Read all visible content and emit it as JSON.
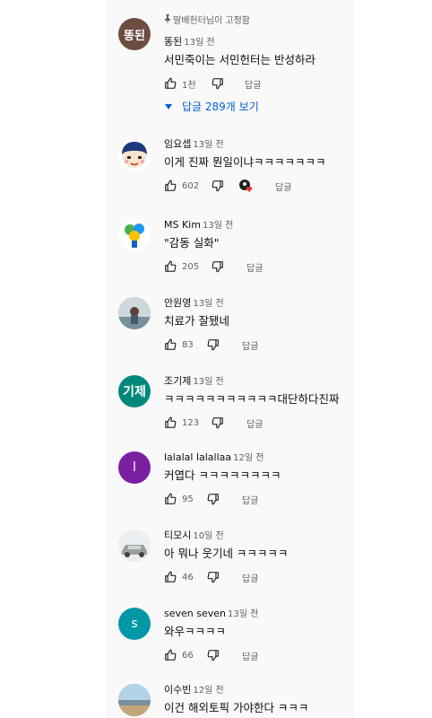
{
  "pinned_label": "딸배헌터님이 고정함",
  "reply_label": "답글",
  "comments": [
    {
      "author": "똥된",
      "time": "13일 전",
      "text": "서민죽이는 서민헌터는 반성하라",
      "likes": "1천",
      "avatar_text": "똥된",
      "avatar_color": "#6d4c41",
      "replies_label": "답글 289개 보기"
    },
    {
      "author": "임요셉",
      "time": "13일 전",
      "text": "이게 진짜 뭔일이냐ㅋㅋㅋㅋㅋㅋㅋ",
      "likes": "602"
    },
    {
      "author": "MS Kim",
      "time": "13일 전",
      "text": "\"감동 실화\"",
      "likes": "205"
    },
    {
      "author": "안원영",
      "time": "13일 전",
      "text": "치료가 잘됐네",
      "likes": "83"
    },
    {
      "author": "조기제",
      "time": "13일 전",
      "text": "ㅋㅋㅋㅋㅋㅋㅋㅋㅋㅋㅋ대단하다진짜",
      "likes": "123",
      "avatar_text": "기제",
      "avatar_color": "#00897b"
    },
    {
      "author": "lalalal lalallaa",
      "time": "12일 전",
      "text": "커엽다 ㅋㅋㅋㅋㅋㅋㅋㅋ",
      "likes": "95",
      "avatar_text": "l",
      "avatar_color": "#7b1fa2"
    },
    {
      "author": "티모시",
      "time": "10일 전",
      "text": "아 뭐나 웃기네 ㅋㅋㅋㅋㅋ",
      "likes": "46"
    },
    {
      "author": "seven seven",
      "time": "13일 전",
      "text": "와우ㅋㅋㅋㅋ",
      "likes": "66",
      "avatar_text": "s",
      "avatar_color": "#0097a7"
    },
    {
      "author": "이수빈",
      "time": "12일 전",
      "text": "이건 해외토픽 가야한다 ㅋㅋㅋ"
    }
  ],
  "colors": {
    "link": "#065fd4",
    "muted": "#606060",
    "panel": "#f9f9f9"
  }
}
